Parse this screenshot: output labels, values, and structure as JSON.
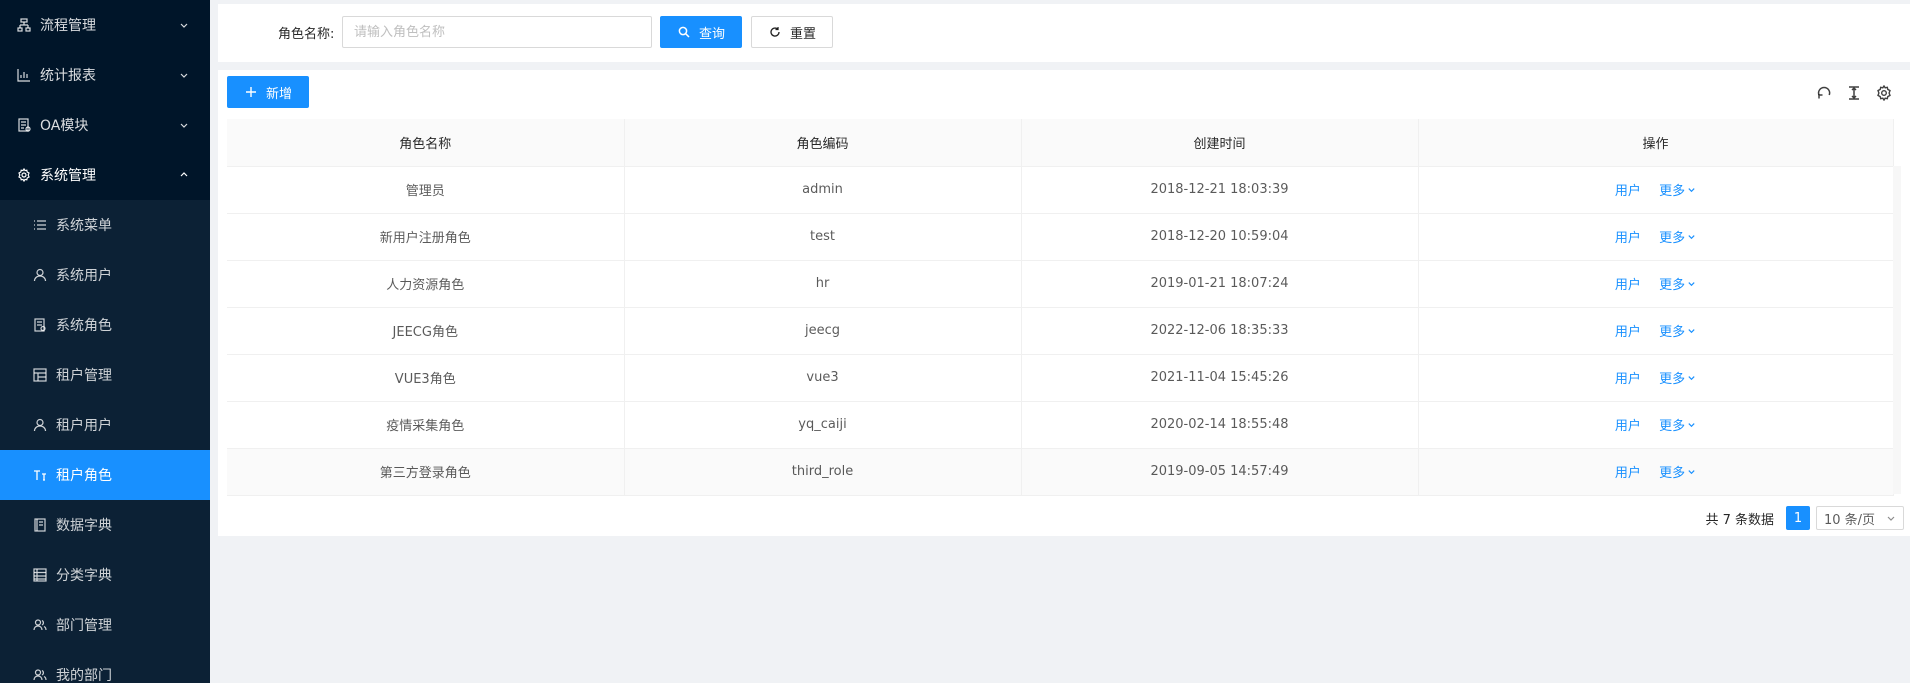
{
  "sidebar": {
    "groups": [
      {
        "label": "流程管理",
        "icon": "flow-icon"
      },
      {
        "label": "统计报表",
        "icon": "chart-icon"
      },
      {
        "label": "OA模块",
        "icon": "doc-icon"
      },
      {
        "label": "系统管理",
        "icon": "gear-icon"
      }
    ],
    "submenu": [
      {
        "label": "系统菜单",
        "icon": "list-icon"
      },
      {
        "label": "系统用户",
        "icon": "user-icon"
      },
      {
        "label": "系统角色",
        "icon": "file-icon"
      },
      {
        "label": "租户管理",
        "icon": "layout-icon"
      },
      {
        "label": "租户用户",
        "icon": "user-icon"
      },
      {
        "label": "租户角色",
        "icon": "text-icon"
      },
      {
        "label": "数据字典",
        "icon": "book-icon"
      },
      {
        "label": "分类字典",
        "icon": "table-icon"
      },
      {
        "label": "部门管理",
        "icon": "team-icon"
      },
      {
        "label": "我的部门",
        "icon": "team-icon"
      }
    ]
  },
  "search": {
    "label": "角色名称:",
    "placeholder": "请输入角色名称",
    "value": "",
    "query_label": "查询",
    "reset_label": "重置"
  },
  "toolbar": {
    "add_label": "新增"
  },
  "table": {
    "columns": [
      "角色名称",
      "角色编码",
      "创建时间",
      "操作"
    ],
    "rows": [
      {
        "name": "管理员",
        "code": "admin",
        "time": "2018-12-21 18:03:39"
      },
      {
        "name": "新用户注册角色",
        "code": "test",
        "time": "2018-12-20 10:59:04"
      },
      {
        "name": "人力资源角色",
        "code": "hr",
        "time": "2019-01-21 18:07:24"
      },
      {
        "name": "JEECG角色",
        "code": "jeecg",
        "time": "2022-12-06 18:35:33"
      },
      {
        "name": "VUE3角色",
        "code": "vue3",
        "time": "2021-11-04 15:45:26"
      },
      {
        "name": "疫情采集角色",
        "code": "yq_caiji",
        "time": "2020-02-14 18:55:48"
      },
      {
        "name": "第三方登录角色",
        "code": "third_role",
        "time": "2019-09-05 14:57:49"
      }
    ],
    "op_user": "用户",
    "op_more": "更多"
  },
  "pagination": {
    "total_text": "共 7 条数据",
    "current_page": "1",
    "page_size": "10 条/页"
  },
  "colors": {
    "primary": "#1890ff",
    "sidebar_bg": "#001529",
    "submenu_bg": "#0c2135"
  }
}
